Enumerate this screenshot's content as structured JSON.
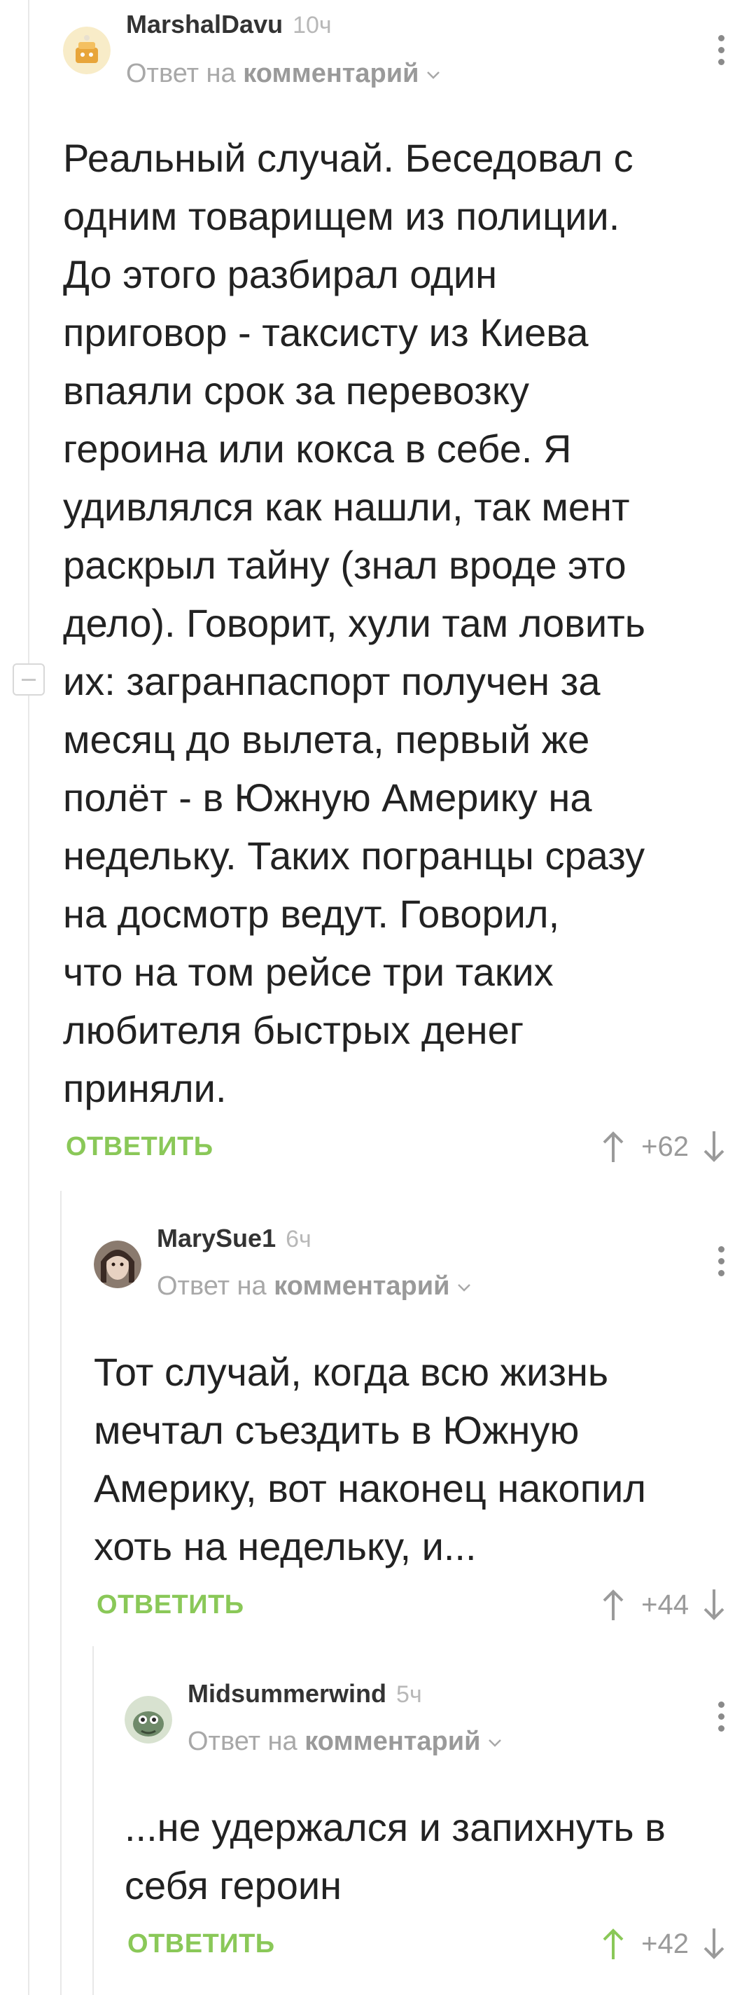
{
  "comments": [
    {
      "username": "MarshalDavu",
      "time": "10ч",
      "reply_prefix": "Ответ на",
      "reply_link": "комментарий",
      "text": "Реальный случай. Беседовал с\nодним товарищем из полиции.\nДо этого разбирал один\nприговор - таксисту из Киева\nвпаяли срок за перевозку\nгероина или кокса в себе. Я\nудивлялся как нашли, так мент\nраскрыл тайну (знал вроде это\nдело). Говорит, хули там ловить\nих: загранпаспорт получен за\nмесяц до вылета, первый же\nполёт - в Южную Америку на\nнедельку. Таких погранцы сразу\nна досмотр ведут. Говорил,\nчто на том рейсе три таких\nлюбителя быстрых денег\nприняли.",
      "reply_label": "ОТВЕТИТЬ",
      "rating": "+62",
      "upvoted": false
    },
    {
      "username": "MarySue1",
      "time": "6ч",
      "reply_prefix": "Ответ на",
      "reply_link": "комментарий",
      "text": "Тот случай, когда всю жизнь\nмечтал съездить в Южную\nАмерику, вот наконец накопил\nхоть на недельку, и...",
      "reply_label": "ОТВЕТИТЬ",
      "rating": "+44",
      "upvoted": false
    },
    {
      "username": "Midsummerwind",
      "time": "5ч",
      "reply_prefix": "Ответ на",
      "reply_link": "комментарий",
      "text": "...не удержался и запихнуть в\nсебя героин",
      "reply_label": "ОТВЕТИТЬ",
      "rating": "+42",
      "upvoted": true
    }
  ],
  "colors": {
    "accent_green": "#8ac858",
    "muted_text": "#a8a8a8",
    "body_text": "#222222",
    "thread_line": "#e8e8e8"
  },
  "icons": {
    "more": "more-vertical-icon",
    "upvote": "arrow-up-icon",
    "downvote": "arrow-down-icon",
    "expand": "chevron-down-icon",
    "collapse": "collapse-minus-icon"
  }
}
